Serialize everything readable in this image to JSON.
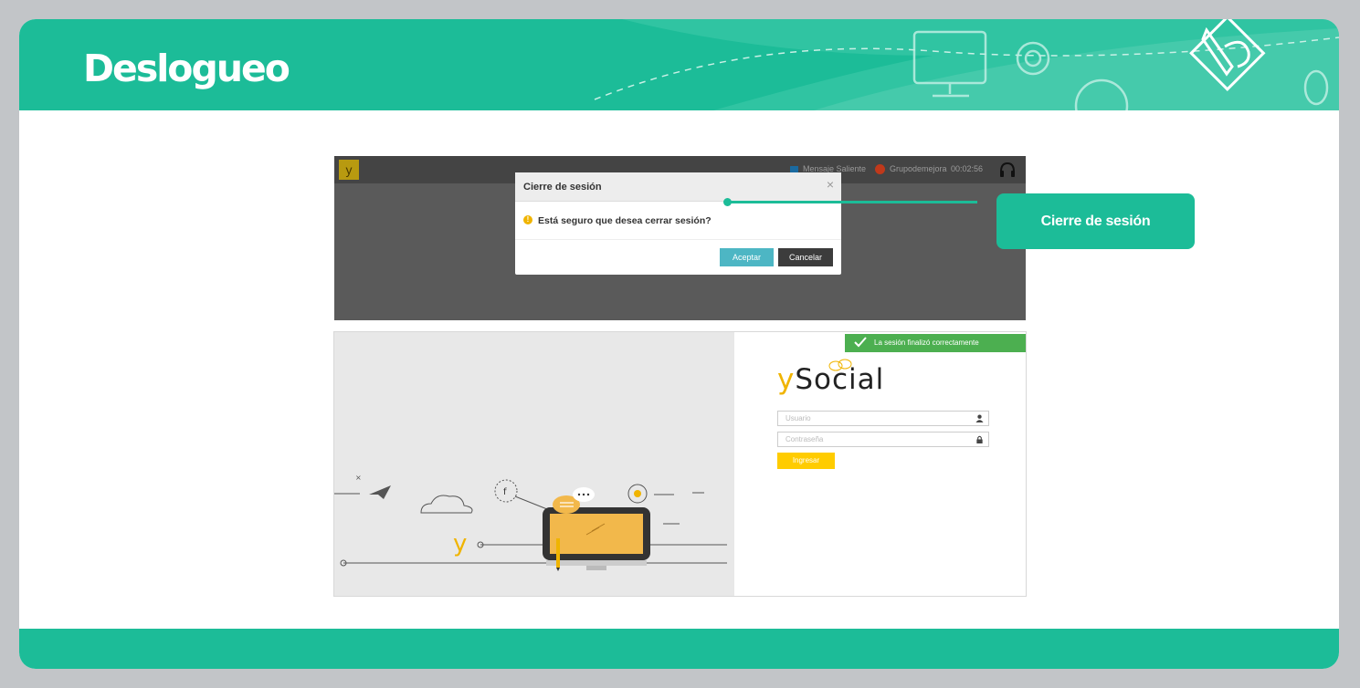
{
  "slide": {
    "title": "Deslogueo",
    "callout": "Cierre de sesión"
  },
  "app_top": {
    "message_label": "Mensaje Saliente",
    "user_label": "Grupodemejora",
    "timer": "00:02:56",
    "logo_glyph": "y"
  },
  "modal": {
    "title": "Cierre de sesión",
    "close_glyph": "×",
    "message": "Está seguro que desea cerrar sesión?",
    "warn_glyph": "!",
    "accept_label": "Aceptar",
    "cancel_label": "Cancelar"
  },
  "login": {
    "toast": "La sesión finalizó correctamente",
    "brand_y": "y",
    "brand_rest": "Social",
    "user_placeholder": "Usuario",
    "password_placeholder": "Contraseña",
    "login_label": "Ingresar"
  },
  "colors": {
    "accent": "#1cbc98",
    "accept_button": "#4db6c4",
    "toast": "#4caf50",
    "login_button": "#ffcc00"
  }
}
